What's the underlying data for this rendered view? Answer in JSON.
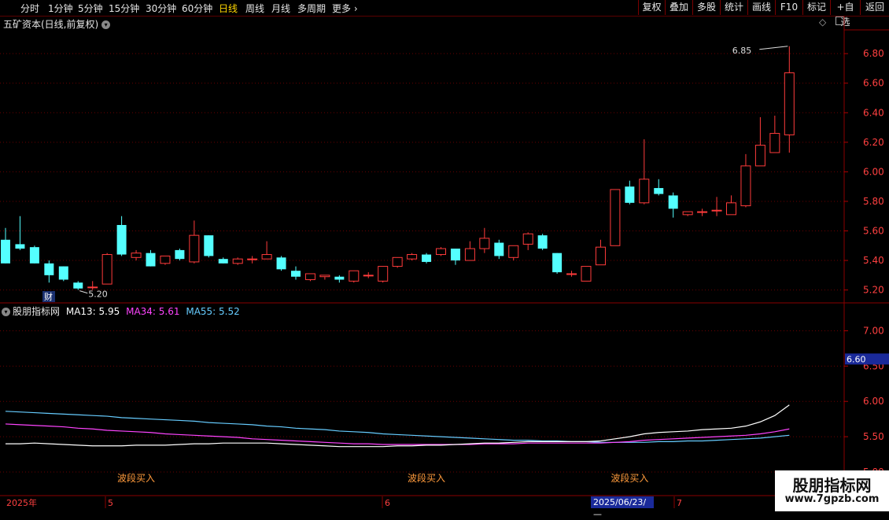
{
  "toolbar": {
    "periods": [
      "分时",
      "1分钟",
      "5分钟",
      "15分钟",
      "30分钟",
      "60分钟",
      "日线",
      "周线",
      "月线",
      "多周期",
      "更多"
    ],
    "active": "日线",
    "buttons": [
      "复权",
      "叠加",
      "多股",
      "统计",
      "画线",
      "F10",
      "标记",
      "+自选",
      "返回"
    ]
  },
  "stock": {
    "title": "五矿资本(日线,前复权)"
  },
  "main_chart": {
    "yticks": [
      "6.80",
      "6.60",
      "6.40",
      "6.20",
      "6.00",
      "5.80",
      "5.60",
      "5.40",
      "5.20"
    ],
    "high_label": "6.85",
    "low_label": "5.20",
    "cai_label": "财"
  },
  "indicator": {
    "name": "股朋指标网",
    "ma13": "MA13: 5.95",
    "ma34": "MA34: 5.61",
    "ma55": "MA55: 5.52",
    "yticks": [
      "7.00",
      "6.50",
      "6.00",
      "5.50",
      "5.00"
    ],
    "current_value": "6.60",
    "signal": "波段买入"
  },
  "timeline": {
    "labels": [
      "2025年",
      "5",
      "6",
      "7"
    ],
    "cursor_date": "2025/06/23/—"
  },
  "watermark": {
    "line1": "股朋指标网",
    "line2": "www.7gpzb.com"
  },
  "colors": {
    "up": "#ff3b3b",
    "down": "#54ffff",
    "ma13": "#ffffff",
    "ma34": "#ff44ff",
    "ma55": "#66ccff"
  },
  "chart_data": {
    "type": "candlestick",
    "candles": [
      [
        5.54,
        5.38,
        5.62,
        5.38
      ],
      [
        5.51,
        5.48,
        5.7,
        5.47
      ],
      [
        5.49,
        5.38,
        5.5,
        5.38
      ],
      [
        5.38,
        5.3,
        5.4,
        5.25
      ],
      [
        5.36,
        5.27,
        5.36,
        5.26
      ],
      [
        5.25,
        5.21,
        5.26,
        5.2
      ],
      [
        5.22,
        5.22,
        5.26,
        5.2
      ],
      [
        5.24,
        5.44,
        5.45,
        5.24
      ],
      [
        5.64,
        5.44,
        5.7,
        5.43
      ],
      [
        5.42,
        5.45,
        5.47,
        5.4
      ],
      [
        5.45,
        5.36,
        5.47,
        5.36
      ],
      [
        5.38,
        5.43,
        5.43,
        5.37
      ],
      [
        5.47,
        5.41,
        5.48,
        5.4
      ],
      [
        5.39,
        5.57,
        5.67,
        5.38
      ],
      [
        5.57,
        5.43,
        5.57,
        5.42
      ],
      [
        5.41,
        5.38,
        5.42,
        5.38
      ],
      [
        5.38,
        5.41,
        5.42,
        5.37
      ],
      [
        5.41,
        5.41,
        5.43,
        5.38
      ],
      [
        5.41,
        5.44,
        5.53,
        5.41
      ],
      [
        5.42,
        5.34,
        5.43,
        5.33
      ],
      [
        5.33,
        5.29,
        5.36,
        5.27
      ],
      [
        5.27,
        5.31,
        5.31,
        5.26
      ],
      [
        5.29,
        5.3,
        5.3,
        5.27
      ],
      [
        5.29,
        5.27,
        5.3,
        5.25
      ],
      [
        5.26,
        5.33,
        5.33,
        5.25
      ],
      [
        5.3,
        5.3,
        5.32,
        5.28
      ],
      [
        5.26,
        5.36,
        5.36,
        5.25
      ],
      [
        5.36,
        5.42,
        5.42,
        5.35
      ],
      [
        5.41,
        5.44,
        5.45,
        5.4
      ],
      [
        5.44,
        5.39,
        5.45,
        5.38
      ],
      [
        5.44,
        5.48,
        5.49,
        5.43
      ],
      [
        5.48,
        5.4,
        5.48,
        5.37
      ],
      [
        5.4,
        5.48,
        5.53,
        5.4
      ],
      [
        5.48,
        5.55,
        5.62,
        5.45
      ],
      [
        5.52,
        5.43,
        5.54,
        5.41
      ],
      [
        5.42,
        5.5,
        5.5,
        5.4
      ],
      [
        5.51,
        5.58,
        5.59,
        5.47
      ],
      [
        5.57,
        5.48,
        5.58,
        5.47
      ],
      [
        5.45,
        5.32,
        5.45,
        5.31
      ],
      [
        5.31,
        5.31,
        5.33,
        5.29
      ],
      [
        5.26,
        5.36,
        5.36,
        5.26
      ],
      [
        5.37,
        5.49,
        5.54,
        5.37
      ],
      [
        5.5,
        5.88,
        5.88,
        5.5
      ],
      [
        5.9,
        5.79,
        5.94,
        5.78
      ],
      [
        5.79,
        5.95,
        6.22,
        5.78
      ],
      [
        5.89,
        5.85,
        5.95,
        5.84
      ],
      [
        5.84,
        5.75,
        5.86,
        5.69
      ],
      [
        5.71,
        5.73,
        5.73,
        5.7
      ],
      [
        5.73,
        5.73,
        5.75,
        5.7
      ],
      [
        5.74,
        5.74,
        5.83,
        5.7
      ],
      [
        5.71,
        5.79,
        5.84,
        5.71
      ],
      [
        5.77,
        6.04,
        6.12,
        5.76
      ],
      [
        6.04,
        6.18,
        6.37,
        6.04
      ],
      [
        6.13,
        6.26,
        6.38,
        6.13
      ],
      [
        6.25,
        6.67,
        6.85,
        6.13
      ]
    ],
    "ma13": [
      5.4,
      5.4,
      5.41,
      5.4,
      5.39,
      5.38,
      5.37,
      5.37,
      5.37,
      5.38,
      5.38,
      5.38,
      5.39,
      5.4,
      5.4,
      5.41,
      5.41,
      5.41,
      5.41,
      5.4,
      5.39,
      5.38,
      5.37,
      5.36,
      5.36,
      5.36,
      5.36,
      5.37,
      5.37,
      5.38,
      5.38,
      5.39,
      5.4,
      5.41,
      5.41,
      5.42,
      5.43,
      5.43,
      5.43,
      5.43,
      5.43,
      5.44,
      5.47,
      5.5,
      5.54,
      5.56,
      5.57,
      5.58,
      5.6,
      5.61,
      5.62,
      5.65,
      5.71,
      5.8,
      5.95
    ],
    "ma34": [
      5.68,
      5.67,
      5.66,
      5.65,
      5.64,
      5.62,
      5.61,
      5.59,
      5.58,
      5.57,
      5.56,
      5.54,
      5.53,
      5.52,
      5.51,
      5.5,
      5.49,
      5.47,
      5.46,
      5.45,
      5.44,
      5.43,
      5.42,
      5.41,
      5.4,
      5.4,
      5.39,
      5.39,
      5.39,
      5.39,
      5.39,
      5.39,
      5.39,
      5.4,
      5.4,
      5.4,
      5.41,
      5.41,
      5.41,
      5.41,
      5.41,
      5.41,
      5.42,
      5.43,
      5.45,
      5.46,
      5.47,
      5.48,
      5.49,
      5.5,
      5.51,
      5.52,
      5.54,
      5.57,
      5.61
    ],
    "ma55": [
      5.86,
      5.85,
      5.84,
      5.83,
      5.82,
      5.81,
      5.8,
      5.79,
      5.77,
      5.76,
      5.75,
      5.74,
      5.73,
      5.72,
      5.7,
      5.69,
      5.68,
      5.67,
      5.65,
      5.64,
      5.62,
      5.61,
      5.6,
      5.58,
      5.57,
      5.56,
      5.54,
      5.53,
      5.52,
      5.51,
      5.5,
      5.49,
      5.48,
      5.47,
      5.46,
      5.45,
      5.45,
      5.44,
      5.44,
      5.43,
      5.43,
      5.42,
      5.42,
      5.42,
      5.42,
      5.43,
      5.43,
      5.44,
      5.44,
      5.45,
      5.46,
      5.47,
      5.48,
      5.5,
      5.52
    ],
    "main_ylim": [
      5.15,
      6.95
    ],
    "ind_ylim": [
      5.0,
      7.25
    ],
    "signals": [
      9,
      29,
      43
    ]
  }
}
